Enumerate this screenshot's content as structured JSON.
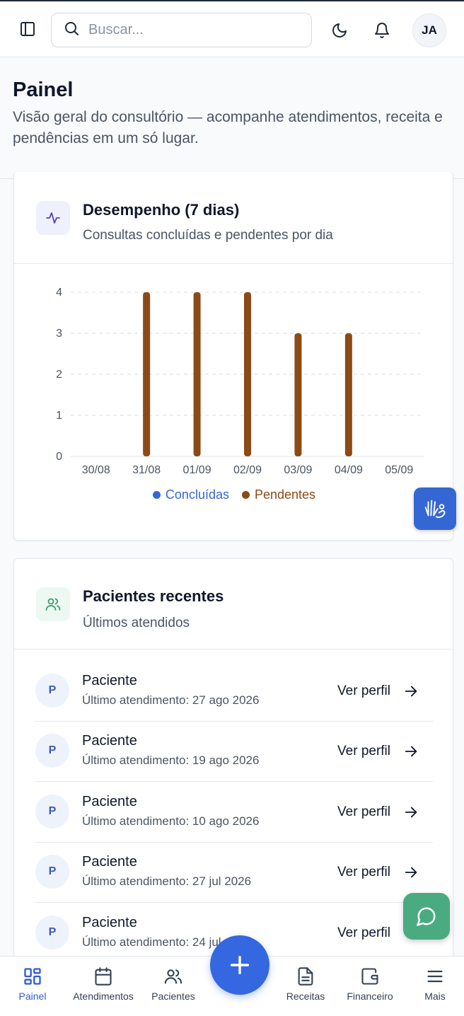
{
  "header": {
    "search_placeholder": "Buscar...",
    "avatar_initials": "JA"
  },
  "page": {
    "title": "Painel",
    "subtitle": "Visão geral do consultório — acompanhe atendimentos, receita e pendências em um só lugar."
  },
  "performance_card": {
    "title": "Desempenho (7 dias)",
    "subtitle": "Consultas concluídas e pendentes por dia"
  },
  "chart_data": {
    "type": "bar",
    "categories": [
      "30/08",
      "31/08",
      "01/09",
      "02/09",
      "03/09",
      "04/09",
      "05/09"
    ],
    "series": [
      {
        "name": "Concluídas",
        "color": "#3567d4",
        "values": [
          0,
          0,
          0,
          0,
          0,
          0,
          0
        ]
      },
      {
        "name": "Pendentes",
        "color": "#8b4a17",
        "values": [
          0,
          4,
          4,
          4,
          3,
          3,
          0
        ]
      }
    ],
    "ylim": [
      0,
      4
    ],
    "yticks": [
      "0",
      "1",
      "2",
      "3",
      "4"
    ],
    "grid": true,
    "legend": "bottom"
  },
  "patients_card": {
    "title": "Pacientes recentes",
    "subtitle": "Últimos atendidos",
    "link_label": "Ver perfil",
    "patients": [
      {
        "initial": "P",
        "name": "Paciente",
        "last_visit": "Último atendimento: 27 ago 2026"
      },
      {
        "initial": "P",
        "name": "Paciente",
        "last_visit": "Último atendimento: 19 ago 2026"
      },
      {
        "initial": "P",
        "name": "Paciente",
        "last_visit": "Último atendimento: 10 ago 2026"
      },
      {
        "initial": "P",
        "name": "Paciente",
        "last_visit": "Último atendimento: 27 jul 2026"
      },
      {
        "initial": "P",
        "name": "Paciente",
        "last_visit": "Último atendimento: 24 jul"
      }
    ]
  },
  "bottom_nav": {
    "items": [
      {
        "label": "Painel",
        "icon": "grid-icon",
        "active": true
      },
      {
        "label": "Atendimentos",
        "icon": "calendar-icon",
        "active": false
      },
      {
        "label": "Pacientes",
        "icon": "users-icon",
        "active": false
      },
      {
        "label": "Receitas",
        "icon": "document-icon",
        "active": false
      },
      {
        "label": "Financeiro",
        "icon": "wallet-icon",
        "active": false
      },
      {
        "label": "Mais",
        "icon": "menu-icon",
        "active": false
      }
    ]
  },
  "colors": {
    "accent": "#3567e0",
    "pending": "#8b4a17",
    "completed": "#3567d4",
    "chat": "#4aab81"
  }
}
